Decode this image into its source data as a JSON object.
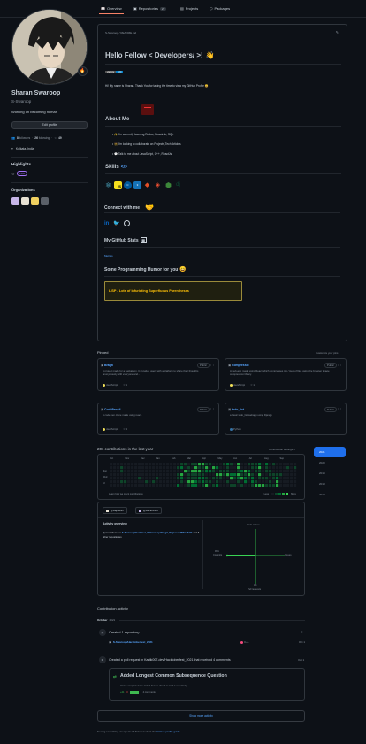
{
  "tabs": [
    {
      "label": "Overview",
      "icon": "book-icon",
      "active": true
    },
    {
      "label": "Repositories",
      "icon": "repo-icon",
      "count": "27"
    },
    {
      "label": "Projects",
      "icon": "project-icon"
    },
    {
      "label": "Packages",
      "icon": "package-icon"
    }
  ],
  "profile": {
    "name": "Sharan Swaroop",
    "username": "S-Swaroop",
    "bio": "Working on becoming human",
    "edit_label": "Edit profile",
    "followers_count": "8",
    "followers_label": "followers",
    "following_count": "26",
    "following_label": "following",
    "stars_count": "49",
    "location": "Kolkata, India",
    "highlights_title": "Highlights",
    "pro_badge": "PRO",
    "orgs_title": "Organizations",
    "status_emoji": "🔥"
  },
  "readme": {
    "path": "S-Swaroop / README.md",
    "greeting": "Hello Fellow < Developers/ >!",
    "wave": "👋",
    "badge_label": "visitors",
    "badge_value": "100",
    "intro": "Hi! My name is Sharan. Thank You for taking the time to view my GitHub Profile 😄",
    "about_title": "About Me",
    "about_items": [
      "I'm currently learning Redux, Reactrub, SQL",
      "I'm looking to collaborate on Projects,Tech Articles",
      "Talk to me about JavaScript, C++, ReactJs"
    ],
    "skills_title": "Skills",
    "connect_title": "Connect with me",
    "stats_title": "My GitHub Stats",
    "stats_alt": "Metrics",
    "humor_title": "Some Programming Humor for you",
    "humor_text": "LISP - Lots of Infuriating Superfluous Parentheses"
  },
  "pinned": {
    "title": "Pinned",
    "customize": "Customize your pins",
    "public_label": "Public",
    "cards": [
      {
        "name": "Bragit",
        "desc": "A project made for a hackathon. It provides users with a platform to share their thoughts anonymously with everyone and...",
        "lang": "JavaScript",
        "lang_color": "#f1e05a",
        "stars": "1"
      },
      {
        "name": "Compressio",
        "desc": "A web-app made using React which compresses jpg / jpeg of files using the browser image compression library.",
        "lang": "JavaScript",
        "lang_color": "#f1e05a",
        "stars": "1"
      },
      {
        "name": "CodePencil",
        "desc": "A code pen clone made using react.",
        "lang": "JavaScript",
        "lang_color": "#f1e05a",
        "stars": "4"
      },
      {
        "name": "todo_list",
        "desc": "a basic todo_list webapp using Django",
        "lang": "Python",
        "lang_color": "#3572A5",
        "stars": ""
      }
    ]
  },
  "contrib": {
    "title": "201 contributions in the last year",
    "settings": "Contribution settings",
    "months": [
      "Oct",
      "Nov",
      "Dec",
      "Jan",
      "Feb",
      "Mar",
      "Apr",
      "May",
      "Jun",
      "Jul",
      "Aug",
      "Sep"
    ],
    "days": [
      "Mon",
      "Wed",
      "Fri"
    ],
    "learn": "Learn how we count contributions",
    "less": "Less",
    "more": "More",
    "years": [
      "2021",
      "2020",
      "2019",
      "2018",
      "2017"
    ],
    "orgs": [
      "@Rajneesh",
      "@HackOn2.0"
    ],
    "activity_title": "Activity overview",
    "contributed_prefix": "Contributed to",
    "contributed_repos": "S-Swaroop/Hacktest, S-Swaroop/Bragit, Rajneesh/IIIT HACK",
    "contributed_suffix": "and 5 other repositories",
    "axis_top": "Code review",
    "axis_left": "Commits",
    "axis_right": "Issues",
    "axis_bottom": "Pull requests",
    "commits_pct": "99%",
    "pr_pct": "1%"
  },
  "activity": {
    "title": "Contribution activity",
    "month": "October",
    "year": "2021",
    "created_repo_text": "Created 1 repository",
    "created_repo_name": "S-Swaroop/Hacktoberfest_2021",
    "repo_lang": "C++",
    "repo_lang_color": "#f34b7d",
    "repo_date": "Oct 1",
    "pr_text": "Created a pull request in Kartik007-dev/Hacktoberfest_2021 that received 4 comments",
    "pr_date": "Oct 1",
    "pr_title": "Added Longest Common Subsequence Question",
    "pr_body": "I have completed the task 1 but we check to task 1 need help",
    "pr_additions": "+41",
    "pr_deletions": "-0",
    "pr_comments": "4 comments",
    "show_more": "Show more activity",
    "footer_text": "Seeing something unexpected? Take a look at the",
    "footer_link": "GitHub profile guide"
  },
  "colors": {
    "bg": "#0d1117",
    "border": "#30363d",
    "link": "#58a6ff",
    "accent": "#f78166",
    "green": "#39d353"
  }
}
